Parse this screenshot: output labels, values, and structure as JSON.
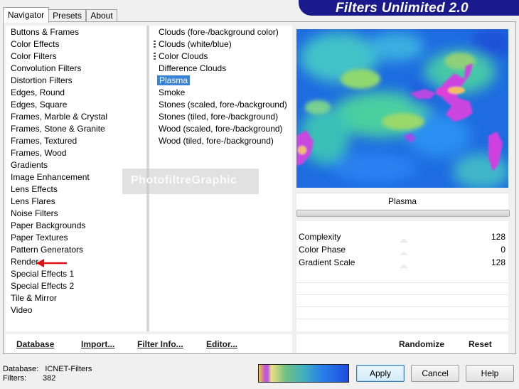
{
  "tabs": [
    "Navigator",
    "Presets",
    "About"
  ],
  "title": "Filters Unlimited 2.0",
  "categories": [
    "Buttons & Frames",
    "Color Effects",
    "Color Filters",
    "Convolution Filters",
    "Distortion Filters",
    "Edges, Round",
    "Edges, Square",
    "Frames, Marble & Crystal",
    "Frames, Stone & Granite",
    "Frames, Textured",
    "Frames, Wood",
    "Gradients",
    "Image Enhancement",
    "Lens Effects",
    "Lens Flares",
    "Noise Filters",
    "Paper Backgrounds",
    "Paper Textures",
    "Pattern Generators",
    "Render",
    "Special Effects 1",
    "Special Effects 2",
    "Tile & Mirror",
    "Video"
  ],
  "filters": [
    {
      "label": "Clouds (fore-/background color)",
      "favorite": false,
      "selected": false
    },
    {
      "label": "Clouds (white/blue)",
      "favorite": true,
      "selected": false
    },
    {
      "label": "Color Clouds",
      "favorite": true,
      "selected": false
    },
    {
      "label": "Difference Clouds",
      "favorite": false,
      "selected": false
    },
    {
      "label": "Plasma",
      "favorite": false,
      "selected": true
    },
    {
      "label": "Smoke",
      "favorite": false,
      "selected": false
    },
    {
      "label": "Stones (scaled, fore-/background)",
      "favorite": false,
      "selected": false
    },
    {
      "label": "Stones (tiled, fore-/background)",
      "favorite": false,
      "selected": false
    },
    {
      "label": "Wood (scaled, fore-/background)",
      "favorite": false,
      "selected": false
    },
    {
      "label": "Wood (tiled, fore-/background)",
      "favorite": false,
      "selected": false
    }
  ],
  "watermark": "PhotofiltreGraphic",
  "preview": {
    "filter_name": "Plasma"
  },
  "params": [
    {
      "name": "Complexity",
      "value": "128"
    },
    {
      "name": "Color Phase",
      "value": "0"
    },
    {
      "name": "Gradient Scale",
      "value": "128"
    }
  ],
  "bottom_links": {
    "database": "Database",
    "import": "Import...",
    "filter_info": "Filter Info...",
    "editor": "Editor..."
  },
  "param_buttons": {
    "randomize": "Randomize",
    "reset": "Reset"
  },
  "status": {
    "database_label": "Database:",
    "database_value": "ICNET-Filters",
    "filters_label": "Filters:",
    "filters_value": "382"
  },
  "dialog_buttons": {
    "apply": "Apply",
    "cancel": "Cancel",
    "help": "Help"
  },
  "annotation": {
    "arrow_color": "#e01010",
    "points_to": "Render"
  },
  "colors": {
    "banner": "#1a1a8c",
    "selection": "#3a84d8"
  }
}
